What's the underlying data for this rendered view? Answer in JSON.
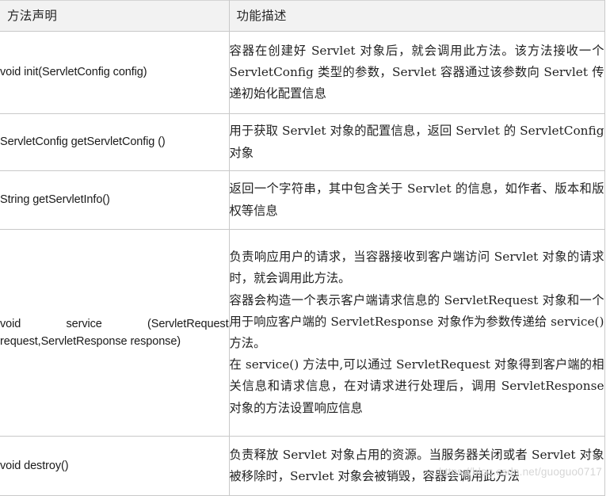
{
  "table": {
    "headers": {
      "method": "方法声明",
      "description": "功能描述"
    },
    "rows": [
      {
        "method": "void init(ServletConfig config)",
        "description": "容器在创建好 Servlet 对象后，就会调用此方法。该方法接收一个 ServletConfig 类型的参数，Servlet 容器通过该参数向 Servlet 传递初始化配置信息",
        "paragraphs": [
          "容器在创建好 Servlet 对象后，就会调用此方法。该方法接收一个 ServletConfig 类型的参数，Servlet 容器通过该参数向 Servlet 传递初始化配置信息"
        ]
      },
      {
        "method": "ServletConfig getServletConfig ()",
        "description": "用于获取 Servlet 对象的配置信息，返回 Servlet 的 ServletConfig 对象",
        "paragraphs": [
          "用于获取 Servlet 对象的配置信息，返回 Servlet 的 ServletConfig 对象"
        ]
      },
      {
        "method": "String getServletInfo()",
        "description": "返回一个字符串，其中包含关于 Servlet 的信息，如作者、版本和版权等信息",
        "paragraphs": [
          "返回一个字符串，其中包含关于 Servlet 的信息，如作者、版本和版权等信息"
        ]
      },
      {
        "method": "void service (ServletRequest request,ServletResponse response)",
        "method_line1": "void service (ServletRequest",
        "method_line2": "request,ServletResponse response)",
        "description": "负责响应用户的请求，当容器接收到客户端访问 Servlet 对象的请求时，就会调用此方法。容器会构造一个表示客户端请求信息的 ServletRequest 对象和一个用于响应客户端的 ServletResponse 对象作为参数传递给 service() 方法。在 service() 方法中,可以通过 ServletRequest 对象得到客户端的相关信息和请求信息，在对请求进行处理后，调用 ServletResponse 对象的方法设置响应信息",
        "paragraphs": [
          "负责响应用户的请求，当容器接收到客户端访问 Servlet 对象的请求时，就会调用此方法。",
          "容器会构造一个表示客户端请求信息的 ServletRequest 对象和一个用于响应客户端的 ServletResponse 对象作为参数传递给 service() 方法。",
          "在 service() 方法中,可以通过 ServletRequest 对象得到客户端的相关信息和请求信息，在对请求进行处理后，调用 ServletResponse 对象的方法设置响应信息"
        ]
      },
      {
        "method": "void destroy()",
        "description": "负责释放 Servlet 对象占用的资源。当服务器关闭或者 Servlet 对象被移除时，Servlet 对象会被销毁，容器会调用此方法",
        "paragraphs": [
          "负责释放 Servlet 对象占用的资源。当服务器关闭或者 Servlet 对象被移除时，Servlet 对象会被销毁，容器会调用此方法"
        ]
      }
    ]
  },
  "watermark": {
    "text": "https://blog.csdn.net/guoguo0717"
  },
  "colors": {
    "header_background": "#f2f2f2",
    "border": "#c9c9c9",
    "text": "#1a1a1a",
    "watermark": "#d6d6d6"
  }
}
